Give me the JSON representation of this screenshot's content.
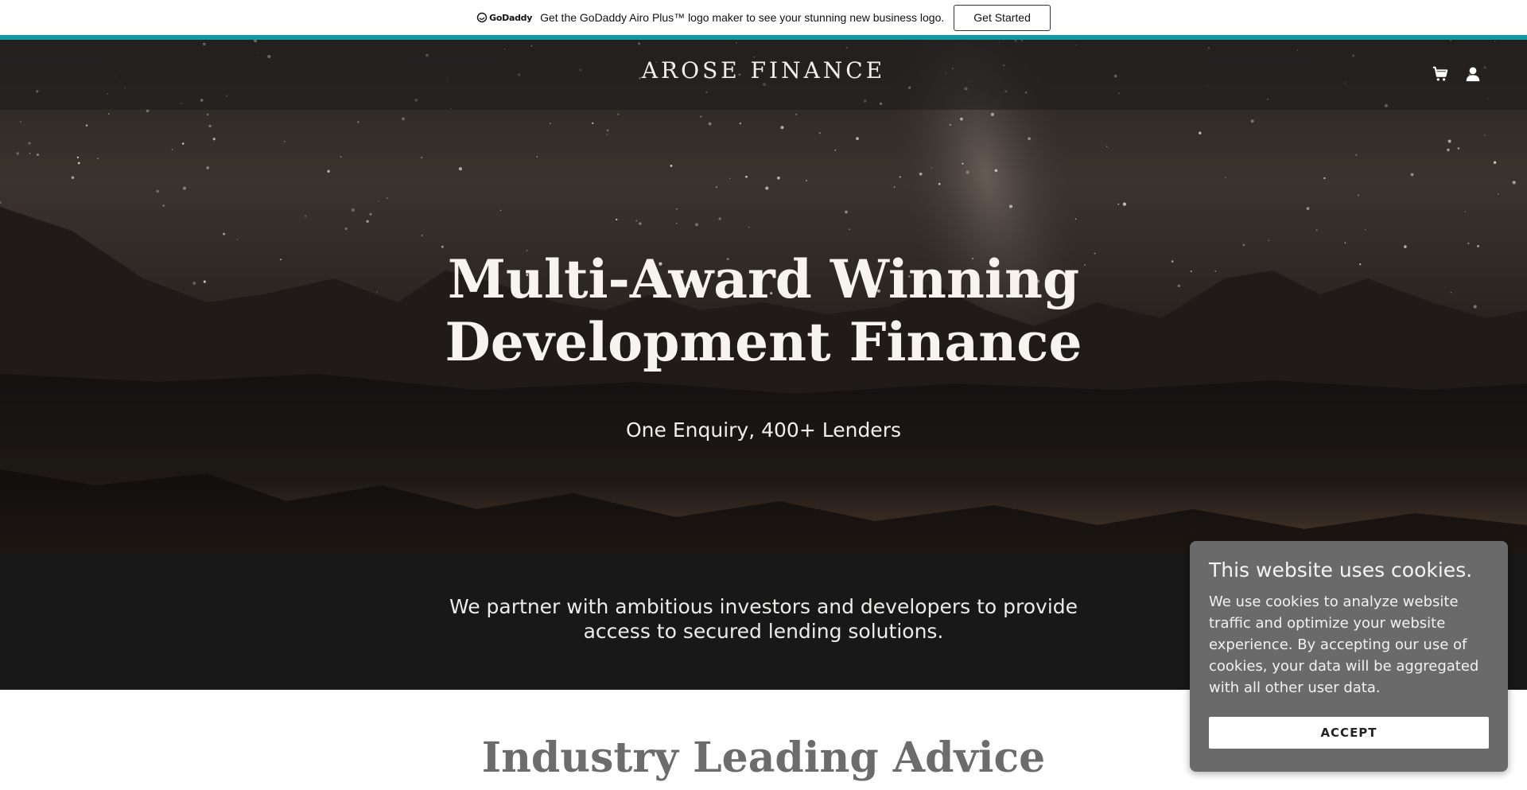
{
  "promo": {
    "logo_text": "GoDaddy",
    "message": "Get the GoDaddy Airo Plus™ logo maker to see your stunning new business logo.",
    "cta_label": "Get Started",
    "accent_color": "#139aa3"
  },
  "header": {
    "brand": "AROSE FINANCE",
    "icons": [
      "cart-icon",
      "account-icon"
    ]
  },
  "hero": {
    "title": "Multi-Award Winning Development Finance",
    "subtitle": "One Enquiry, 400+ Lenders"
  },
  "partner": {
    "text": "We partner with ambitious investors and developers to provide access to secured lending solutions."
  },
  "section": {
    "heading": "Industry Leading Advice"
  },
  "cookies": {
    "title": "This website uses cookies.",
    "body": "We use cookies to analyze website traffic and optimize your website experience. By accepting our use of cookies, your data will be aggregated with all other user data.",
    "accept_label": "ACCEPT"
  }
}
